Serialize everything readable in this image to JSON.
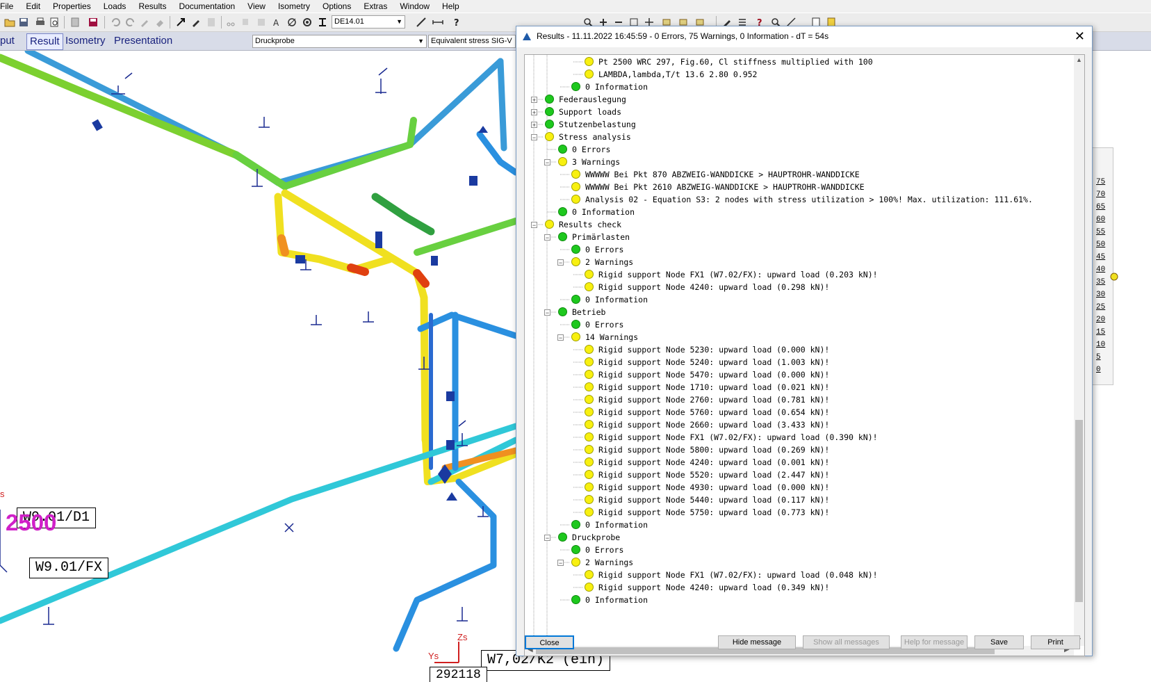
{
  "menu": [
    "File",
    "Edit",
    "Properties",
    "Loads",
    "Results",
    "Documentation",
    "View",
    "Isometry",
    "Options",
    "Extras",
    "Window",
    "Help"
  ],
  "toolbar": {
    "version_combo": "DE14.01",
    "loadcase_combo": "Druckprobe",
    "result_combo": "Equivalent stress SIG-V"
  },
  "tabs": [
    "put",
    "Result",
    "Isometry",
    "Presentation"
  ],
  "active_tab": "Result",
  "model_labels": {
    "node_label_1": "W9.01/D1",
    "node_label_2": "W9.01/FX",
    "node_label_3": "W7,02/K2 (ein)",
    "node_label_4": "292118",
    "point_number": "2500",
    "axis_z": "Zs",
    "axis_y": "Ys",
    "stub_s": "s"
  },
  "scale_labels": [
    "75",
    "70",
    "65",
    "60",
    "55",
    "50",
    "45",
    "40",
    "35",
    "30",
    "25",
    "20",
    "15",
    "10",
    "5",
    "0"
  ],
  "dialog": {
    "title": "Results - 11.11.2022  16:45:59 - 0 Errors, 75 Warnings, 0 Information - dT = 54s",
    "close_glyph": "✕",
    "rows": [
      {
        "text": "Pt 2500 WRC 297, Fig.60, Cl stiffness multiplied with 100",
        "color": "yellow",
        "level": 3,
        "exp": ""
      },
      {
        "text": "LAMBDA,lambda,T/t   13.6      2.80     0.952",
        "color": "yellow",
        "level": 3,
        "exp": ""
      },
      {
        "text": "0 Information",
        "color": "green",
        "level": 2,
        "exp": ""
      },
      {
        "text": "Federauslegung",
        "color": "green",
        "level": 0,
        "exp": "+"
      },
      {
        "text": "Support loads",
        "color": "green",
        "level": 0,
        "exp": "+"
      },
      {
        "text": "Stutzenbelastung",
        "color": "green",
        "level": 0,
        "exp": "+"
      },
      {
        "text": "Stress analysis",
        "color": "yellow",
        "level": 0,
        "exp": "-"
      },
      {
        "text": "0 Errors",
        "color": "green",
        "level": 1,
        "exp": ""
      },
      {
        "text": "3 Warnings",
        "color": "yellow",
        "level": 1,
        "exp": "-"
      },
      {
        "text": "WWWWW Bei Pkt 870  ABZWEIG-WANDDICKE >  HAUPTROHR-WANDDICKE",
        "color": "yellow",
        "level": 2,
        "exp": ""
      },
      {
        "text": "WWWWW Bei Pkt 2610 ABZWEIG-WANDDICKE >  HAUPTROHR-WANDDICKE",
        "color": "yellow",
        "level": 2,
        "exp": ""
      },
      {
        "text": "Analysis 02 - Equation S3: 2 nodes with stress utilization > 100%! Max. utilization: 111.61%.",
        "color": "yellow",
        "level": 2,
        "exp": ""
      },
      {
        "text": "0 Information",
        "color": "green",
        "level": 1,
        "exp": ""
      },
      {
        "text": "Results check",
        "color": "yellow",
        "level": 0,
        "exp": "-"
      },
      {
        "text": "Primärlasten",
        "color": "green",
        "level": 1,
        "exp": "-"
      },
      {
        "text": "0 Errors",
        "color": "green",
        "level": 2,
        "exp": ""
      },
      {
        "text": "2 Warnings",
        "color": "yellow",
        "level": 2,
        "exp": "-"
      },
      {
        "text": "Rigid support Node FX1 (W7.02/FX): upward load (0.203 kN)!",
        "color": "yellow",
        "level": 3,
        "exp": ""
      },
      {
        "text": "Rigid support Node 4240: upward load (0.298 kN)!",
        "color": "yellow",
        "level": 3,
        "exp": ""
      },
      {
        "text": "0 Information",
        "color": "green",
        "level": 2,
        "exp": ""
      },
      {
        "text": "Betrieb",
        "color": "green",
        "level": 1,
        "exp": "-"
      },
      {
        "text": "0 Errors",
        "color": "green",
        "level": 2,
        "exp": ""
      },
      {
        "text": "14 Warnings",
        "color": "yellow",
        "level": 2,
        "exp": "-"
      },
      {
        "text": "Rigid support Node 5230: upward load (0.000 kN)!",
        "color": "yellow",
        "level": 3,
        "exp": ""
      },
      {
        "text": "Rigid support Node 5240: upward load (1.003 kN)!",
        "color": "yellow",
        "level": 3,
        "exp": ""
      },
      {
        "text": "Rigid support Node 5470: upward load (0.000 kN)!",
        "color": "yellow",
        "level": 3,
        "exp": ""
      },
      {
        "text": "Rigid support Node 1710: upward load (0.021 kN)!",
        "color": "yellow",
        "level": 3,
        "exp": ""
      },
      {
        "text": "Rigid support Node 2760: upward load (0.781 kN)!",
        "color": "yellow",
        "level": 3,
        "exp": ""
      },
      {
        "text": "Rigid support Node 5760: upward load (0.654 kN)!",
        "color": "yellow",
        "level": 3,
        "exp": ""
      },
      {
        "text": "Rigid support Node 2660: upward load (3.433 kN)!",
        "color": "yellow",
        "level": 3,
        "exp": ""
      },
      {
        "text": "Rigid support Node FX1 (W7.02/FX): upward load (0.390 kN)!",
        "color": "yellow",
        "level": 3,
        "exp": ""
      },
      {
        "text": "Rigid support Node 5800: upward load (0.269 kN)!",
        "color": "yellow",
        "level": 3,
        "exp": ""
      },
      {
        "text": "Rigid support Node 4240: upward load (0.001 kN)!",
        "color": "yellow",
        "level": 3,
        "exp": ""
      },
      {
        "text": "Rigid support Node 5520: upward load (2.447 kN)!",
        "color": "yellow",
        "level": 3,
        "exp": ""
      },
      {
        "text": "Rigid support Node 4930: upward load (0.000 kN)!",
        "color": "yellow",
        "level": 3,
        "exp": ""
      },
      {
        "text": "Rigid support Node 5440: upward load (0.117 kN)!",
        "color": "yellow",
        "level": 3,
        "exp": ""
      },
      {
        "text": "Rigid support Node 5750: upward load (0.773 kN)!",
        "color": "yellow",
        "level": 3,
        "exp": ""
      },
      {
        "text": "0 Information",
        "color": "green",
        "level": 2,
        "exp": ""
      },
      {
        "text": "Druckprobe",
        "color": "green",
        "level": 1,
        "exp": "-"
      },
      {
        "text": "0 Errors",
        "color": "green",
        "level": 2,
        "exp": ""
      },
      {
        "text": "2 Warnings",
        "color": "yellow",
        "level": 2,
        "exp": "-"
      },
      {
        "text": "Rigid support Node FX1 (W7.02/FX): upward load (0.048 kN)!",
        "color": "yellow",
        "level": 3,
        "exp": ""
      },
      {
        "text": "Rigid support Node 4240: upward load (0.349 kN)!",
        "color": "yellow",
        "level": 3,
        "exp": ""
      },
      {
        "text": "0 Information",
        "color": "green",
        "level": 2,
        "exp": ""
      }
    ],
    "buttons": {
      "close": "Close",
      "hide": "Hide message",
      "show_all": "Show all messages",
      "help": "Help for message",
      "save": "Save",
      "print": "Print"
    }
  },
  "colors": {
    "green_status": "#1ec81e",
    "yellow_status": "#f8f010",
    "accent": "#0078d7"
  }
}
